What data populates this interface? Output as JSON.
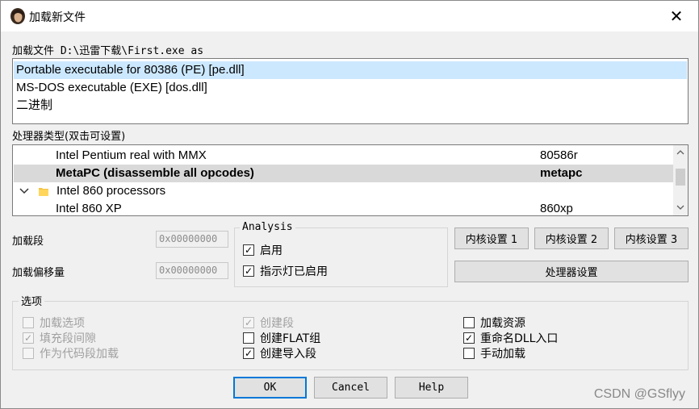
{
  "window": {
    "title": "加载新文件",
    "close_symbol": "✕"
  },
  "file_label": "加载文件 D:\\迅雷下载\\First.exe as",
  "file_types": [
    {
      "label": "Portable executable for 80386 (PE) [pe.dll]",
      "selected": true
    },
    {
      "label": "MS-DOS executable (EXE) [dos.dll]",
      "selected": false
    },
    {
      "label": "二进制",
      "selected": false
    }
  ],
  "processor_label": "处理器类型(双击可设置)",
  "processors": [
    {
      "name": "Intel Pentium real with MMX",
      "code": "80586r"
    },
    {
      "name": "MetaPC (disassemble all opcodes)",
      "code": "metapc",
      "selected": true
    },
    {
      "name": "Intel 860 processors",
      "code": "",
      "folder": true
    },
    {
      "name": "Intel 860 XP",
      "code": "860xp"
    }
  ],
  "fields": {
    "load_segment_label": "加载段",
    "load_segment_value": "0x00000000",
    "load_offset_label": "加载偏移量",
    "load_offset_value": "0x00000000"
  },
  "analysis": {
    "title": "Analysis",
    "enable_label": "启用",
    "indicator_label": "指示灯已启用"
  },
  "buttons": {
    "kernel1": "内核设置 1",
    "kernel2": "内核设置 2",
    "kernel3": "内核设置 3",
    "processor_settings": "处理器设置",
    "ok": "OK",
    "cancel": "Cancel",
    "help": "Help"
  },
  "options": {
    "title": "选项",
    "load_options": "加载选项",
    "fill_gaps": "填充段间隙",
    "load_as_code": "作为代码段加载",
    "create_segments": "创建段",
    "create_flat": "创建FLAT组",
    "create_imports": "创建导入段",
    "load_resources": "加载资源",
    "rename_dll": "重命名DLL入口",
    "manual_load": "手动加载"
  },
  "watermark": "CSDN @GSflyy",
  "colors": {
    "selection": "#cce8ff",
    "accent": "#0078d7"
  }
}
